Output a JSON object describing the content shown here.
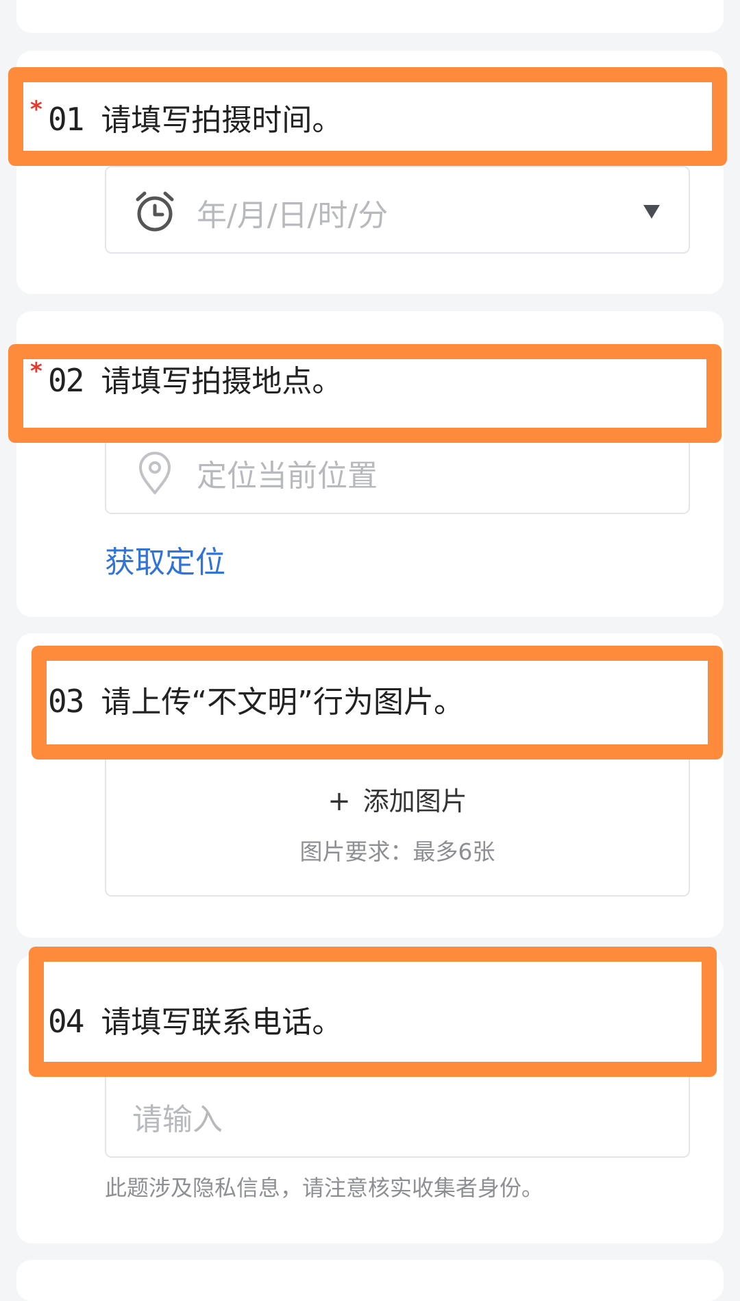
{
  "questions": [
    {
      "number": "01",
      "title": "请填写拍摄时间。",
      "required_mark": "*",
      "placeholder": "年/月/日/时/分",
      "icon": "alarm-clock-icon"
    },
    {
      "number": "02",
      "title": "请填写拍摄地点。",
      "required_mark": "*",
      "placeholder": "定位当前位置",
      "icon": "location-pin-icon",
      "action_label": "获取定位"
    },
    {
      "number": "03",
      "title": "请上传“不文明”行为图片。",
      "upload_label": "添加图片",
      "upload_icon": "plus-icon",
      "requirement_label": "图片要求：",
      "requirement_value": "最多6张"
    },
    {
      "number": "04",
      "title": "请填写联系电话。",
      "placeholder": "请输入",
      "privacy_note": "此题涉及隐私信息，请注意核实收集者身份。"
    }
  ],
  "colors": {
    "highlight": "#fe8a3c",
    "required": "#e8382c",
    "link": "#2f74d6",
    "placeholder": "#b7b9bd",
    "background": "#f4f5f7"
  }
}
